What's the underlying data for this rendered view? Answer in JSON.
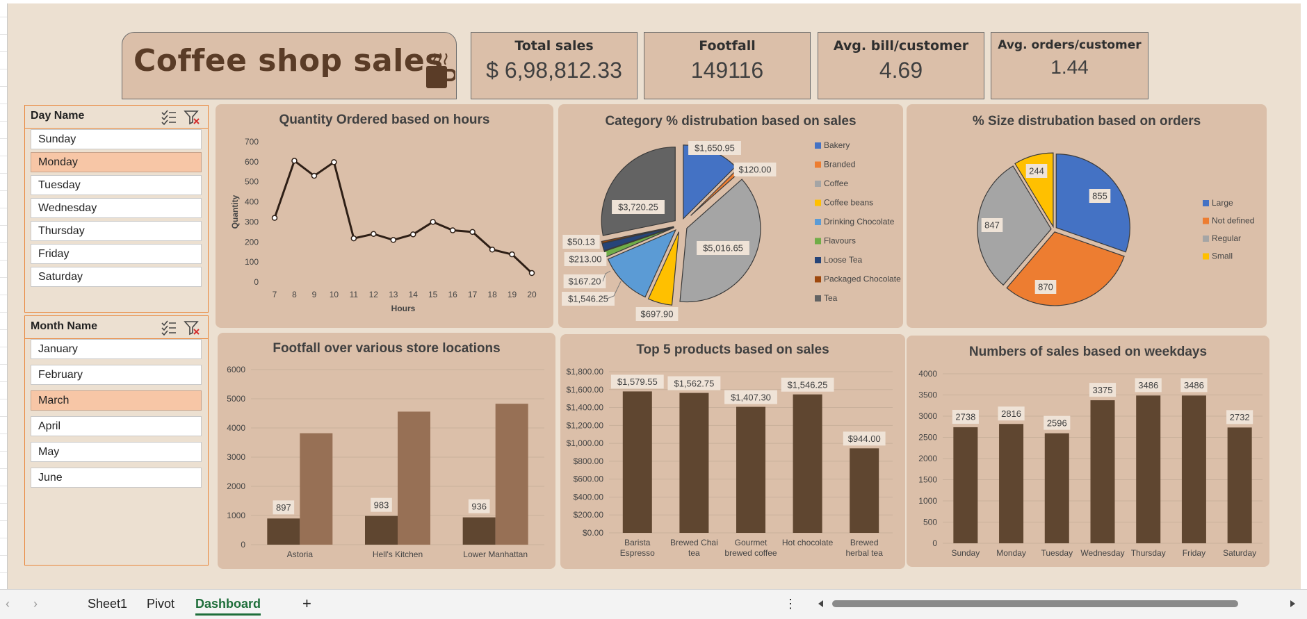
{
  "title": "Coffee shop sales",
  "kpis": [
    {
      "label": "Total sales",
      "value": "$ 6,98,812.33"
    },
    {
      "label": "Footfall",
      "value": "149116"
    },
    {
      "label": "Avg. bill/customer",
      "value": "4.69"
    },
    {
      "label": "Avg. orders/customer",
      "value": "1.44"
    }
  ],
  "slicers": {
    "day": {
      "header": "Day Name",
      "items": [
        "Sunday",
        "Monday",
        "Tuesday",
        "Wednesday",
        "Thursday",
        "Friday",
        "Saturday"
      ],
      "selected": "Monday"
    },
    "month": {
      "header": "Month Name",
      "items": [
        "January",
        "February",
        "March",
        "April",
        "May",
        "June"
      ],
      "selected": "March"
    }
  },
  "colors": {
    "brown_dark": "#5f4630",
    "brown_light": "#977055",
    "line": "#2e1f16",
    "blue": "#4472c4",
    "orange": "#ed7d31",
    "gray": "#a5a5a5",
    "gold": "#ffc000",
    "lightblue": "#5b9bd5",
    "green": "#70ad47",
    "navy": "#264478",
    "rust": "#9e480e",
    "darkgray": "#636363"
  },
  "tabs": [
    "Sheet1",
    "Pivot",
    "Dashboard"
  ],
  "active_tab": "Dashboard",
  "add_sheet_label": "+",
  "more_label": "⋮",
  "chart_data": [
    {
      "id": "hours",
      "type": "line",
      "title": "Quantity Ordered based on hours",
      "xlabel": "Hours",
      "ylabel": "Quantity",
      "x": [
        "7",
        "8",
        "9",
        "10",
        "11",
        "12",
        "13",
        "14",
        "15",
        "16",
        "17",
        "18",
        "19",
        "20"
      ],
      "values": [
        320,
        605,
        530,
        598,
        218,
        240,
        210,
        238,
        300,
        258,
        250,
        162,
        138,
        45
      ],
      "ylim": [
        0,
        700
      ],
      "yticks": [
        "0",
        "100",
        "200",
        "300",
        "400",
        "500",
        "600",
        "700"
      ],
      "grid": false
    },
    {
      "id": "category",
      "type": "pie",
      "title": "Category % distrubation  based on sales",
      "categories": [
        "Bakery",
        "Branded",
        "Coffee",
        "Coffee beans",
        "Drinking Chocolate",
        "Flavours",
        "Loose Tea",
        "Packaged Chocolate",
        "Tea"
      ],
      "values": [
        1650.95,
        120.0,
        5016.65,
        697.9,
        1546.25,
        167.2,
        213.0,
        50.13,
        3720.25
      ],
      "labels": [
        "$1,650.95",
        "$120.00",
        "$5,016.65",
        "$697.90",
        "$1,546.25",
        "$167.20",
        "$213.00",
        "$50.13",
        "$3,720.25"
      ],
      "legend": "right"
    },
    {
      "id": "size",
      "type": "pie",
      "title": "% Size distrubation  based on orders",
      "categories": [
        "Large",
        "Not defined",
        "Regular",
        "Small"
      ],
      "values": [
        855,
        870,
        847,
        244
      ],
      "labels": [
        "855",
        "870",
        "847",
        "244"
      ],
      "legend": "right"
    },
    {
      "id": "footfall",
      "type": "bar",
      "title": "Footfall over various store locations",
      "categories": [
        "Astoria",
        "Hell's Kitchen",
        "Lower Manhattan"
      ],
      "series": [
        {
          "values": [
            897,
            983,
            936
          ],
          "labels": [
            "897",
            "983",
            "936"
          ]
        },
        {
          "values": [
            3820,
            4560,
            4830
          ]
        }
      ],
      "ylim": [
        0,
        6000
      ],
      "yticks": [
        "0",
        "1000",
        "2000",
        "3000",
        "4000",
        "5000",
        "6000"
      ],
      "grid": true
    },
    {
      "id": "products",
      "type": "bar",
      "title": "Top 5 products based on sales",
      "categories": [
        [
          "Barista",
          "Espresso"
        ],
        [
          "Brewed Chai",
          "tea"
        ],
        [
          "Gourmet",
          "brewed coffee"
        ],
        [
          "Hot chocolate"
        ],
        [
          "Brewed",
          "herbal tea"
        ]
      ],
      "values": [
        1579.55,
        1562.75,
        1407.3,
        1546.25,
        944.0
      ],
      "labels": [
        "$1,579.55",
        "$1,562.75",
        "$1,407.30",
        "$1,546.25",
        "$944.00"
      ],
      "ylim": [
        0,
        1800
      ],
      "yticks": [
        "$0.00",
        "$200.00",
        "$400.00",
        "$600.00",
        "$800.00",
        "$1,000.00",
        "$1,200.00",
        "$1,400.00",
        "$1,600.00",
        "$1,800.00"
      ],
      "grid": true
    },
    {
      "id": "weekdays",
      "type": "bar",
      "title": "Numbers of sales based on weekdays",
      "categories": [
        "Sunday",
        "Monday",
        "Tuesday",
        "Wednesday",
        "Thursday",
        "Friday",
        "Saturday"
      ],
      "values": [
        2738,
        2816,
        2596,
        3375,
        3486,
        3486,
        2732
      ],
      "labels": [
        "2738",
        "2816",
        "2596",
        "3375",
        "3486",
        "3486",
        "2732"
      ],
      "ylim": [
        0,
        4000
      ],
      "yticks": [
        "0",
        "500",
        "1000",
        "1500",
        "2000",
        "2500",
        "3000",
        "3500",
        "4000"
      ],
      "grid": true
    }
  ]
}
